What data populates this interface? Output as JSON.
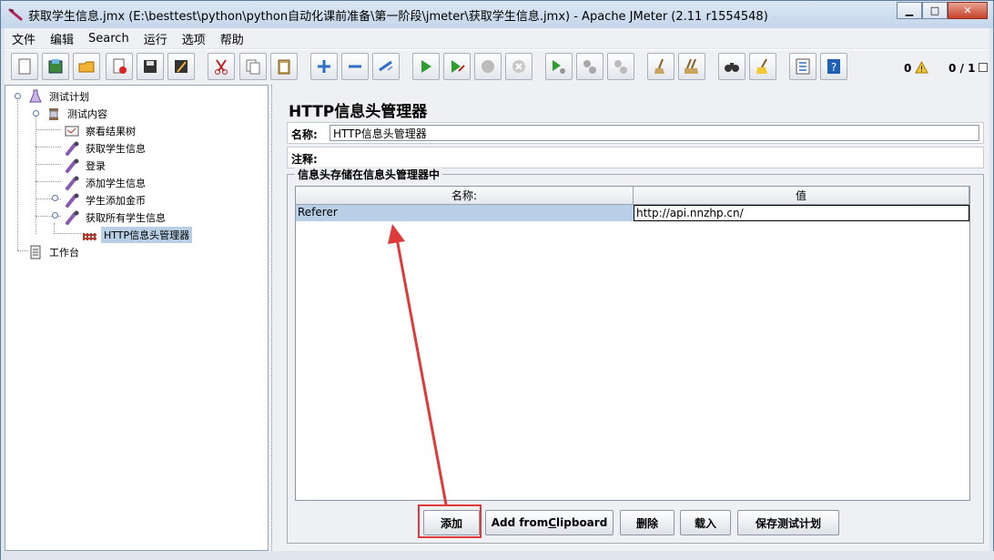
{
  "window": {
    "title": "获取学生信息.jmx (E:\\besttest\\python\\python自动化课前准备\\第一阶段\\jmeter\\获取学生信息.jmx) - Apache JMeter (2.11 r1554548)"
  },
  "menu": [
    "文件",
    "编辑",
    "Search",
    "运行",
    "选项",
    "帮助"
  ],
  "status": {
    "errors": "0",
    "threads": "0 / 1"
  },
  "tree": {
    "test_plan": "测试计划",
    "thread_group": "测试内容",
    "children": [
      "察看结果树",
      "获取学生信息",
      "登录",
      "添加学生信息",
      "学生添加金币",
      "获取所有学生信息"
    ],
    "selected": "HTTP信息头管理器",
    "workbench": "工作台"
  },
  "panel": {
    "title": "HTTP信息头管理器",
    "name_label": "名称:",
    "name_value": "HTTP信息头管理器",
    "comment_label": "注释:",
    "comment_value": "",
    "group_title": "信息头存储在信息头管理器中",
    "columns": [
      "名称:",
      "值"
    ],
    "rows": [
      {
        "name": "Referer",
        "value": "http://api.nnzhp.cn/"
      }
    ]
  },
  "buttons": {
    "add": "添加",
    "add_clipboard_pre": "Add from ",
    "add_clipboard_u": "C",
    "add_clipboard_post": "lipboard",
    "delete": "删除",
    "load": "载入",
    "save": "保存测试计划"
  },
  "colors": {
    "selection": "#b8cfe5",
    "annotation": "#e0393a"
  }
}
